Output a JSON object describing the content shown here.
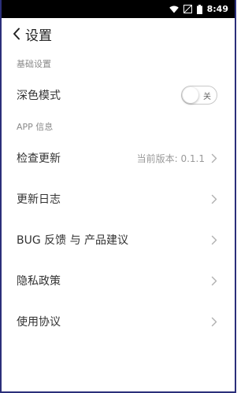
{
  "statusbar": {
    "time": "8:49"
  },
  "titlebar": {
    "title": "设置"
  },
  "sections": {
    "basic": {
      "header": "基础设置",
      "dark_mode": {
        "label": "深色模式",
        "toggle_text": "关",
        "state": "off"
      }
    },
    "app": {
      "header": "APP 信息",
      "items": [
        {
          "label": "检查更新",
          "value": "当前版本: 0.1.1"
        },
        {
          "label": "更新日志",
          "value": ""
        },
        {
          "label": "BUG 反馈 与 产品建议",
          "value": ""
        },
        {
          "label": "隐私政策",
          "value": ""
        },
        {
          "label": "使用协议",
          "value": ""
        }
      ]
    }
  },
  "icons": {
    "back": "chevron-left-icon",
    "chevron": "chevron-right-icon",
    "wifi": "wifi-icon",
    "signal": "no-signal-icon",
    "battery": "battery-icon"
  }
}
